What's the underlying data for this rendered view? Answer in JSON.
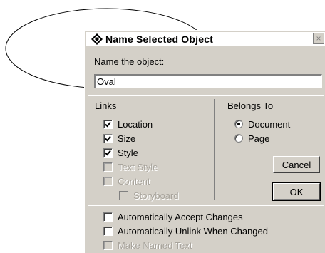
{
  "dialog": {
    "title": "Name Selected Object",
    "close_label": "×",
    "name_label": "Name the object:",
    "name_value": "Oval"
  },
  "links": {
    "heading": "Links",
    "items": [
      {
        "label": "Location",
        "checked": true,
        "enabled": true
      },
      {
        "label": "Size",
        "checked": true,
        "enabled": true
      },
      {
        "label": "Style",
        "checked": true,
        "enabled": true
      },
      {
        "label": "Text Style",
        "checked": false,
        "enabled": false
      },
      {
        "label": "Content",
        "checked": false,
        "enabled": false
      },
      {
        "label": "Storyboard",
        "checked": false,
        "enabled": false
      }
    ]
  },
  "belongs_to": {
    "heading": "Belongs To",
    "options": [
      {
        "label": "Document",
        "selected": true
      },
      {
        "label": "Page",
        "selected": false
      }
    ]
  },
  "buttons": {
    "cancel": "Cancel",
    "ok": "OK"
  },
  "options": [
    {
      "label": "Automatically Accept Changes",
      "checked": false,
      "enabled": true
    },
    {
      "label": "Automatically Unlink When Changed",
      "checked": false,
      "enabled": true
    },
    {
      "label": "Make Named Text",
      "checked": false,
      "enabled": false
    }
  ],
  "icons": {
    "title_icon": "diamond-app-icon",
    "check": "checkmark-icon"
  }
}
